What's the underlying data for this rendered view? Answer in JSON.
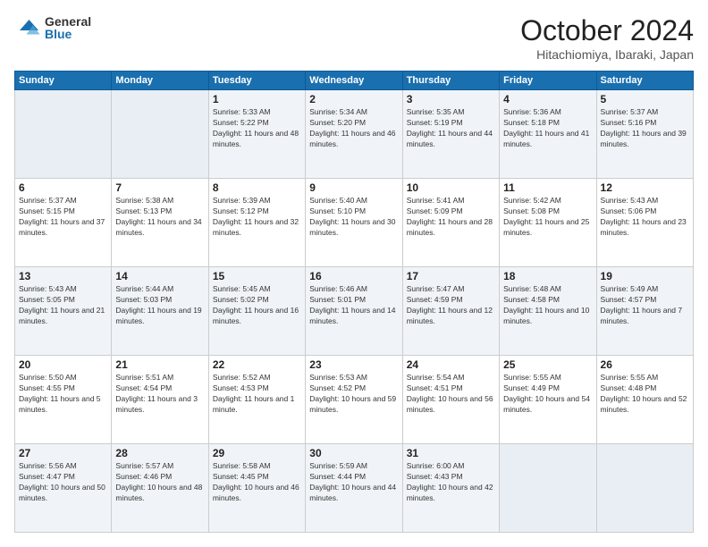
{
  "logo": {
    "general": "General",
    "blue": "Blue"
  },
  "header": {
    "month": "October 2024",
    "location": "Hitachiomiya, Ibaraki, Japan"
  },
  "weekdays": [
    "Sunday",
    "Monday",
    "Tuesday",
    "Wednesday",
    "Thursday",
    "Friday",
    "Saturday"
  ],
  "weeks": [
    [
      {
        "day": "",
        "info": ""
      },
      {
        "day": "",
        "info": ""
      },
      {
        "day": "1",
        "info": "Sunrise: 5:33 AM\nSunset: 5:22 PM\nDaylight: 11 hours and 48 minutes."
      },
      {
        "day": "2",
        "info": "Sunrise: 5:34 AM\nSunset: 5:20 PM\nDaylight: 11 hours and 46 minutes."
      },
      {
        "day": "3",
        "info": "Sunrise: 5:35 AM\nSunset: 5:19 PM\nDaylight: 11 hours and 44 minutes."
      },
      {
        "day": "4",
        "info": "Sunrise: 5:36 AM\nSunset: 5:18 PM\nDaylight: 11 hours and 41 minutes."
      },
      {
        "day": "5",
        "info": "Sunrise: 5:37 AM\nSunset: 5:16 PM\nDaylight: 11 hours and 39 minutes."
      }
    ],
    [
      {
        "day": "6",
        "info": "Sunrise: 5:37 AM\nSunset: 5:15 PM\nDaylight: 11 hours and 37 minutes."
      },
      {
        "day": "7",
        "info": "Sunrise: 5:38 AM\nSunset: 5:13 PM\nDaylight: 11 hours and 34 minutes."
      },
      {
        "day": "8",
        "info": "Sunrise: 5:39 AM\nSunset: 5:12 PM\nDaylight: 11 hours and 32 minutes."
      },
      {
        "day": "9",
        "info": "Sunrise: 5:40 AM\nSunset: 5:10 PM\nDaylight: 11 hours and 30 minutes."
      },
      {
        "day": "10",
        "info": "Sunrise: 5:41 AM\nSunset: 5:09 PM\nDaylight: 11 hours and 28 minutes."
      },
      {
        "day": "11",
        "info": "Sunrise: 5:42 AM\nSunset: 5:08 PM\nDaylight: 11 hours and 25 minutes."
      },
      {
        "day": "12",
        "info": "Sunrise: 5:43 AM\nSunset: 5:06 PM\nDaylight: 11 hours and 23 minutes."
      }
    ],
    [
      {
        "day": "13",
        "info": "Sunrise: 5:43 AM\nSunset: 5:05 PM\nDaylight: 11 hours and 21 minutes."
      },
      {
        "day": "14",
        "info": "Sunrise: 5:44 AM\nSunset: 5:03 PM\nDaylight: 11 hours and 19 minutes."
      },
      {
        "day": "15",
        "info": "Sunrise: 5:45 AM\nSunset: 5:02 PM\nDaylight: 11 hours and 16 minutes."
      },
      {
        "day": "16",
        "info": "Sunrise: 5:46 AM\nSunset: 5:01 PM\nDaylight: 11 hours and 14 minutes."
      },
      {
        "day": "17",
        "info": "Sunrise: 5:47 AM\nSunset: 4:59 PM\nDaylight: 11 hours and 12 minutes."
      },
      {
        "day": "18",
        "info": "Sunrise: 5:48 AM\nSunset: 4:58 PM\nDaylight: 11 hours and 10 minutes."
      },
      {
        "day": "19",
        "info": "Sunrise: 5:49 AM\nSunset: 4:57 PM\nDaylight: 11 hours and 7 minutes."
      }
    ],
    [
      {
        "day": "20",
        "info": "Sunrise: 5:50 AM\nSunset: 4:55 PM\nDaylight: 11 hours and 5 minutes."
      },
      {
        "day": "21",
        "info": "Sunrise: 5:51 AM\nSunset: 4:54 PM\nDaylight: 11 hours and 3 minutes."
      },
      {
        "day": "22",
        "info": "Sunrise: 5:52 AM\nSunset: 4:53 PM\nDaylight: 11 hours and 1 minute."
      },
      {
        "day": "23",
        "info": "Sunrise: 5:53 AM\nSunset: 4:52 PM\nDaylight: 10 hours and 59 minutes."
      },
      {
        "day": "24",
        "info": "Sunrise: 5:54 AM\nSunset: 4:51 PM\nDaylight: 10 hours and 56 minutes."
      },
      {
        "day": "25",
        "info": "Sunrise: 5:55 AM\nSunset: 4:49 PM\nDaylight: 10 hours and 54 minutes."
      },
      {
        "day": "26",
        "info": "Sunrise: 5:55 AM\nSunset: 4:48 PM\nDaylight: 10 hours and 52 minutes."
      }
    ],
    [
      {
        "day": "27",
        "info": "Sunrise: 5:56 AM\nSunset: 4:47 PM\nDaylight: 10 hours and 50 minutes."
      },
      {
        "day": "28",
        "info": "Sunrise: 5:57 AM\nSunset: 4:46 PM\nDaylight: 10 hours and 48 minutes."
      },
      {
        "day": "29",
        "info": "Sunrise: 5:58 AM\nSunset: 4:45 PM\nDaylight: 10 hours and 46 minutes."
      },
      {
        "day": "30",
        "info": "Sunrise: 5:59 AM\nSunset: 4:44 PM\nDaylight: 10 hours and 44 minutes."
      },
      {
        "day": "31",
        "info": "Sunrise: 6:00 AM\nSunset: 4:43 PM\nDaylight: 10 hours and 42 minutes."
      },
      {
        "day": "",
        "info": ""
      },
      {
        "day": "",
        "info": ""
      }
    ]
  ]
}
